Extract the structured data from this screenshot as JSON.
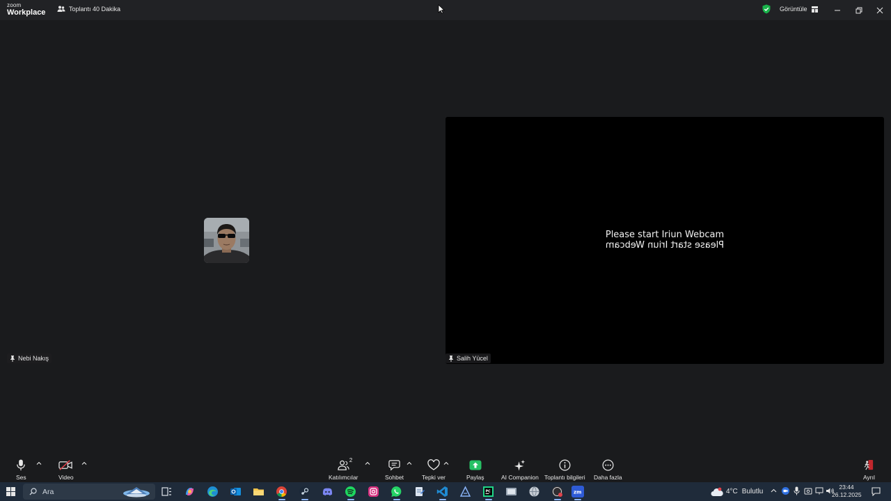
{
  "app": {
    "logo_top": "zoom",
    "logo_bottom": "Workplace"
  },
  "titlebar": {
    "meeting_name": "Toplantı 40 Dakika",
    "view_label": "Görüntüle"
  },
  "participants": [
    {
      "name": "Nebi Nakış",
      "video": "off"
    },
    {
      "name": "Salih Yücel",
      "video": "on"
    }
  ],
  "webcam": {
    "line1": "Please start Iriun Webcam",
    "line2": "Please start Iriun Webcam"
  },
  "toolbar": {
    "audio_label": "Ses",
    "video_label": "Video",
    "participants_label": "Katılımcılar",
    "participants_count": "2",
    "chat_label": "Sohbet",
    "react_label": "Tepki ver",
    "share_label": "Paylaş",
    "ai_label": "AI Companion",
    "info_label": "Toplantı bilgileri",
    "more_label": "Daha fazla",
    "leave_label": "Ayrıl"
  },
  "taskbar": {
    "search_placeholder": "Ara",
    "weather": "4°C",
    "weather_desc": "Bulutlu",
    "time": "23:44",
    "date": "26.12.2025"
  },
  "colors": {
    "share_green": "#27c165",
    "active_app": "#2e5bd6",
    "shield_green": "#19b24a"
  }
}
